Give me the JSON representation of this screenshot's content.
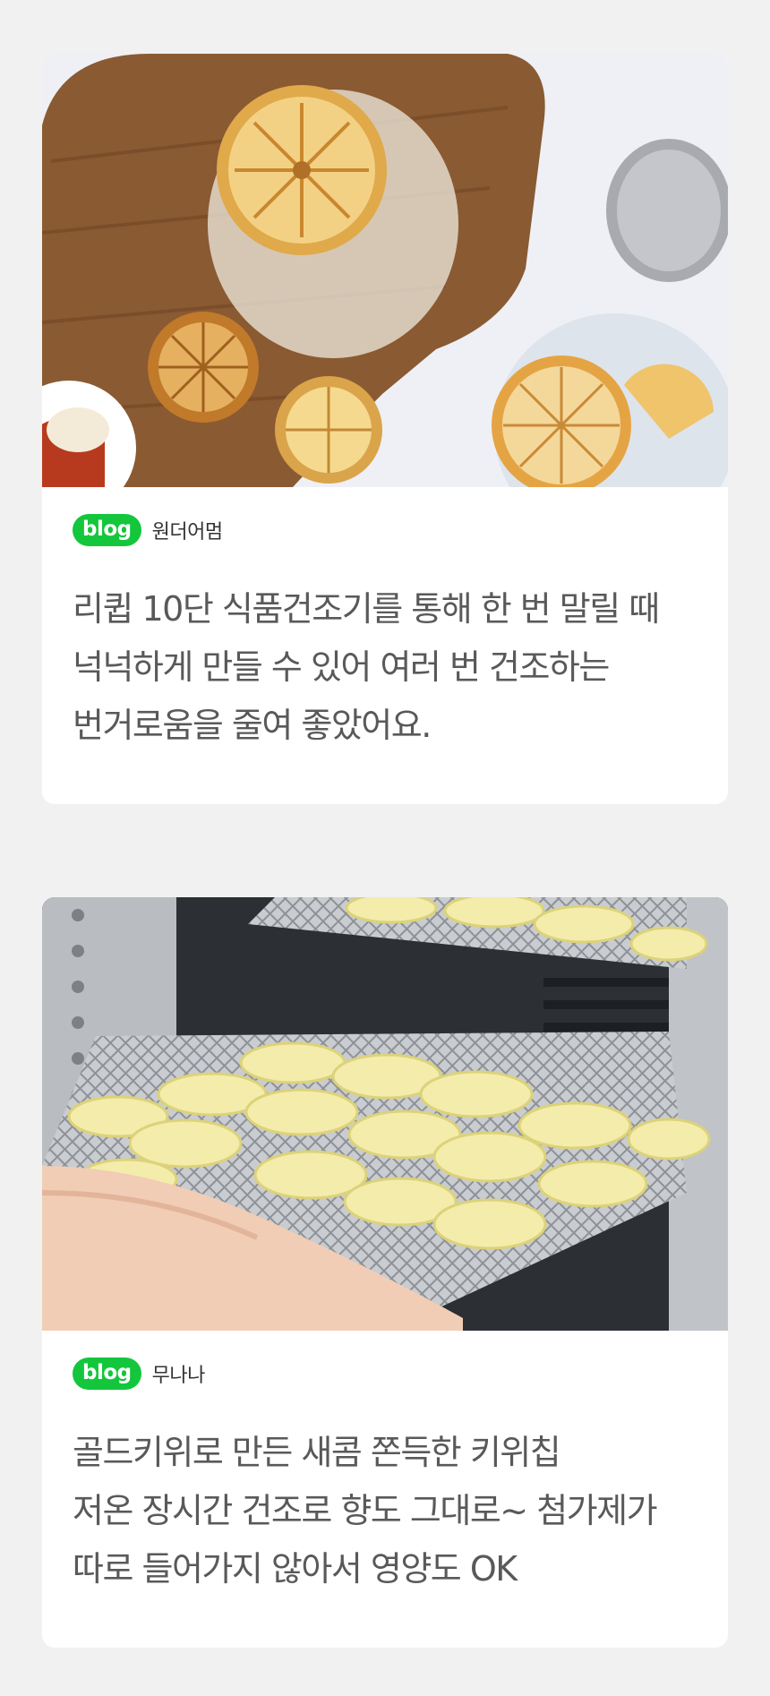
{
  "reviews": [
    {
      "photo": "dried-lemon-slices-jar-photo",
      "badge": "blog",
      "author": "원더어멈",
      "lines": [
        "리큅 10단 식품건조기를 통해 한 번 말릴 때",
        "넉넉하게 만들 수 있어 여러 번 건조하는",
        "번거로움을 줄여 좋았어요."
      ]
    },
    {
      "photo": "kiwi-slices-dehydrator-tray-photo",
      "badge": "blog",
      "author": "무나나",
      "lines": [
        "골드키위로 만든 새콤 쫀득한 키위칩",
        "저온 장시간 건조로 향도 그대로~ 첨가제가",
        "따로 들어가지 않아서 영양도 OK"
      ]
    }
  ],
  "colors": {
    "background": "#f1f1f1",
    "card": "#ffffff",
    "badge": "#14c63c",
    "text": "#595959"
  }
}
